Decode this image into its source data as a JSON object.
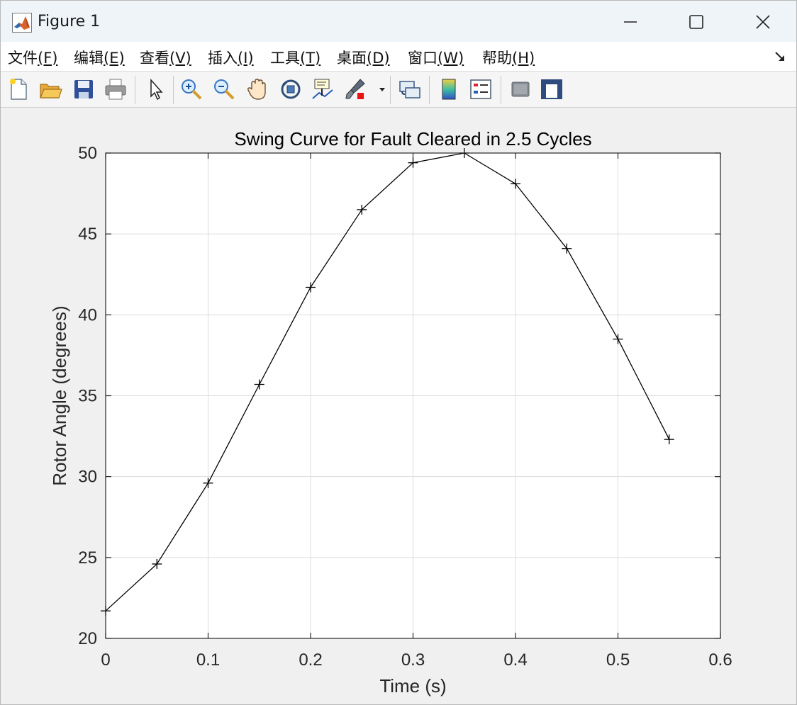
{
  "window": {
    "title": "Figure 1"
  },
  "menu": [
    {
      "label": "文件",
      "mnemonic": "(F)"
    },
    {
      "label": "编辑",
      "mnemonic": "(E)"
    },
    {
      "label": "查看",
      "mnemonic": "(V)"
    },
    {
      "label": "插入",
      "mnemonic": "(I)"
    },
    {
      "label": "工具",
      "mnemonic": "(T)"
    },
    {
      "label": "桌面",
      "mnemonic": "(D)"
    },
    {
      "label": "窗口",
      "mnemonic": "(W)"
    },
    {
      "label": "帮助",
      "mnemonic": "(H)"
    }
  ],
  "toolbar": {
    "icons": [
      "new-figure-icon",
      "open-file-icon",
      "save-icon",
      "print-icon",
      "edit-plot-pointer-icon",
      "zoom-in-icon",
      "zoom-out-icon",
      "pan-hand-icon",
      "rotate-3d-icon",
      "data-cursor-icon",
      "brush-icon",
      "link-plot-icon",
      "colorbar-icon",
      "legend-icon",
      "hide-plot-tools-icon",
      "show-plot-tools-icon"
    ]
  },
  "colors": {
    "line": "#000000",
    "grid": "#dcdcdc",
    "figure_bg": "#f0f0f0",
    "axes_bg": "#ffffff"
  },
  "chart_data": {
    "type": "line",
    "title": "Swing Curve for Fault Cleared in 2.5 Cycles",
    "xlabel": "Time (s)",
    "ylabel": "Rotor Angle (degrees)",
    "xlim": [
      0,
      0.6
    ],
    "ylim": [
      20,
      50
    ],
    "xticks": [
      0,
      0.1,
      0.2,
      0.3,
      0.4,
      0.5,
      0.6
    ],
    "xtick_labels": [
      "0",
      "0.1",
      "0.2",
      "0.3",
      "0.4",
      "0.5",
      "0.6"
    ],
    "yticks": [
      20,
      25,
      30,
      35,
      40,
      45,
      50
    ],
    "ytick_labels": [
      "20",
      "25",
      "30",
      "35",
      "40",
      "45",
      "50"
    ],
    "grid": true,
    "marker": "+",
    "x": [
      0,
      0.05,
      0.1,
      0.15,
      0.2,
      0.25,
      0.3,
      0.35,
      0.4,
      0.45,
      0.5,
      0.55
    ],
    "y": [
      21.7,
      24.6,
      29.6,
      35.7,
      41.7,
      46.5,
      49.4,
      50.0,
      48.1,
      44.1,
      38.5,
      32.3
    ]
  }
}
